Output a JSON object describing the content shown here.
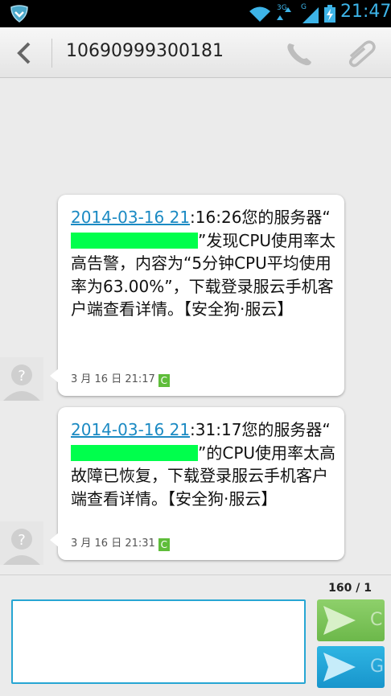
{
  "status_bar": {
    "time": "21:47",
    "network_3g_label": "3G",
    "network_g_label": "G",
    "icons": [
      "shield-icon",
      "wifi-icon",
      "signal-icon",
      "battery-charging-icon"
    ]
  },
  "header": {
    "contact_number": "10690999300181",
    "icons": [
      "back-arrow-icon",
      "phone-icon",
      "paperclip-icon"
    ]
  },
  "messages": [
    {
      "date_link": "2014-03-16 21",
      "text_part1": ":16:26您的服务器“",
      "text_part2": "”发现CPU使用率太高告警，内容为“5分钟CPU平均使用率为63.00%”，下载登录服云手机客户端查看详情。【安全狗·服云】",
      "timestamp": "3 月 16 日 21:17",
      "badge": "C"
    },
    {
      "date_link": "2014-03-16 21",
      "text_part1": ":31:17您的服务器“",
      "text_part2": "”的CPU使用率太高故障已恢复，下载登录服云手机客户端查看详情。【安全狗·服云】",
      "timestamp": "3 月 16 日 21:31",
      "badge": "C"
    }
  ],
  "composer": {
    "char_count": "160 / 1",
    "input_value": "",
    "send_button_1_label": "C",
    "send_button_2_label": "G"
  },
  "colors": {
    "accent": "#27a6d3",
    "link": "#1b8ac3",
    "redaction": "#00ff4c",
    "send_green": "#7cc55a",
    "send_blue": "#23a7dc"
  }
}
